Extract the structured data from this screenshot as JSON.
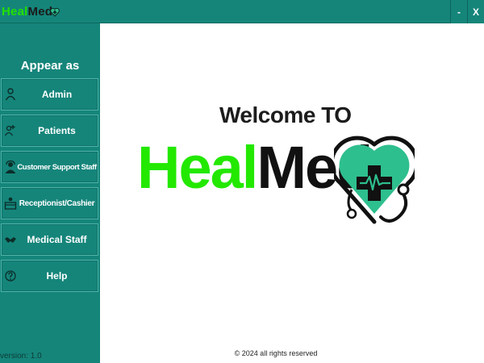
{
  "window": {
    "title_part1": "Heal",
    "title_part2": "Med",
    "minimize_label": "-",
    "close_label": "X"
  },
  "sidebar": {
    "heading": "Appear as",
    "items": [
      {
        "label": "Admin",
        "icon": "admin-icon"
      },
      {
        "label": "Patients",
        "icon": "patients-icon"
      },
      {
        "label": "Customer Support Staff",
        "icon": "support-staff-icon"
      },
      {
        "label": "Receptionist/Cashier",
        "icon": "receptionist-icon"
      },
      {
        "label": "Medical Staff",
        "icon": "handshake-icon"
      },
      {
        "label": "Help",
        "icon": "help-icon"
      }
    ],
    "version": "version: 1.0"
  },
  "main": {
    "welcome": "Welcome TO",
    "brand_part1": "Heal",
    "brand_part2": "Med",
    "copyright": "© 2024 all rights reserved"
  },
  "colors": {
    "teal": "#15857a",
    "brand_green": "#23e800",
    "heart_fill": "#2ebf8e"
  }
}
